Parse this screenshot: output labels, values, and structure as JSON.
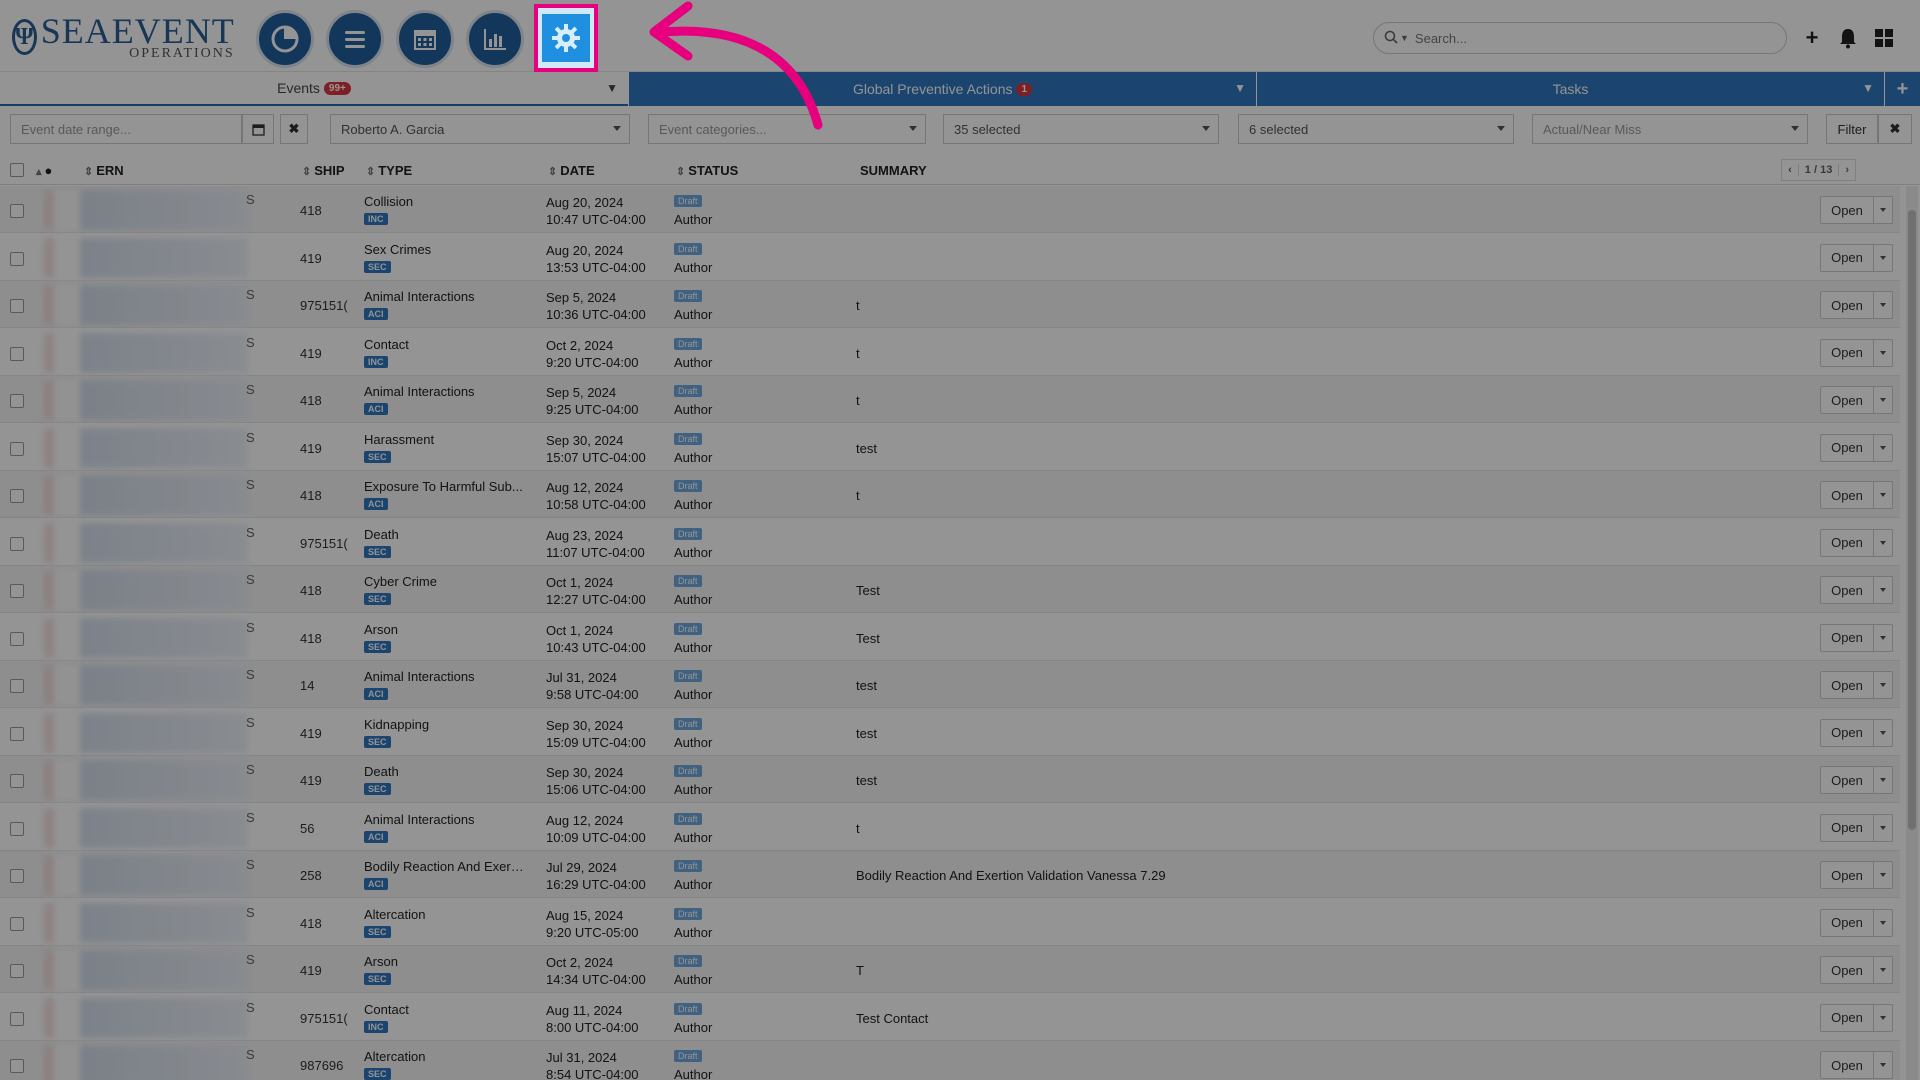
{
  "app": {
    "logo_main": "SEAEVENT",
    "logo_sub": "OPERATIONS",
    "logo_mark": "Ψ"
  },
  "nav": {
    "icons": [
      "dashboard-pie-icon",
      "list-icon",
      "calendar-icon",
      "bar-chart-icon",
      "gear-icon"
    ]
  },
  "header": {
    "search_placeholder": "Search...",
    "add_icon": "+",
    "bell_icon": "bell-icon",
    "apps_icon": "grid-icon"
  },
  "tabs": [
    {
      "label": "Events",
      "badge": "99+"
    },
    {
      "label": "Global Preventive Actions",
      "badge": "1"
    },
    {
      "label": "Tasks",
      "badge": ""
    }
  ],
  "filters": {
    "date_placeholder": "Event date range...",
    "user_value": "Roberto A. Garcia",
    "category_placeholder": "Event categories...",
    "ships_value": "35 selected",
    "types_value": "6 selected",
    "classification_placeholder": "Actual/Near Miss",
    "filter_label": "Filter",
    "clear_label": "✖"
  },
  "table": {
    "columns": {
      "ern": "ERN",
      "ship": "SHIP",
      "type": "TYPE",
      "date": "DATE",
      "status": "STATUS",
      "summary": "SUMMARY"
    },
    "pager": "1 / 13",
    "open_label": "Open",
    "rows": [
      {
        "ern_s": "S",
        "ship": "418",
        "type": "Collision",
        "tag": "INC",
        "date1": "Aug 20, 2024",
        "date2": "10:47 UTC-04:00",
        "status": "Draft",
        "role": "Author",
        "summary": ""
      },
      {
        "ern_s": "",
        "ship": "419",
        "type": "Sex Crimes",
        "tag": "SEC",
        "date1": "Aug 20, 2024",
        "date2": "13:53 UTC-04:00",
        "status": "Draft",
        "role": "Author",
        "summary": ""
      },
      {
        "ern_s": "S",
        "ship": "975151(",
        "type": "Animal Interactions",
        "tag": "ACI",
        "date1": "Sep 5, 2024",
        "date2": "10:36 UTC-04:00",
        "status": "Draft",
        "role": "Author",
        "summary": "t"
      },
      {
        "ern_s": "S",
        "ship": "419",
        "type": "Contact",
        "tag": "INC",
        "date1": "Oct 2, 2024",
        "date2": "9:20 UTC-04:00",
        "status": "Draft",
        "role": "Author",
        "summary": "t"
      },
      {
        "ern_s": "S",
        "ship": "418",
        "type": "Animal Interactions",
        "tag": "ACI",
        "date1": "Sep 5, 2024",
        "date2": "9:25 UTC-04:00",
        "status": "Draft",
        "role": "Author",
        "summary": "t"
      },
      {
        "ern_s": "S",
        "ship": "419",
        "type": "Harassment",
        "tag": "SEC",
        "date1": "Sep 30, 2024",
        "date2": "15:07 UTC-04:00",
        "status": "Draft",
        "role": "Author",
        "summary": "test"
      },
      {
        "ern_s": "S",
        "ship": "418",
        "type": "Exposure To Harmful Sub...",
        "tag": "ACI",
        "date1": "Aug 12, 2024",
        "date2": "10:58 UTC-04:00",
        "status": "Draft",
        "role": "Author",
        "summary": "t"
      },
      {
        "ern_s": "S",
        "ship": "975151(",
        "type": "Death",
        "tag": "SEC",
        "date1": "Aug 23, 2024",
        "date2": "11:07 UTC-04:00",
        "status": "Draft",
        "role": "Author",
        "summary": ""
      },
      {
        "ern_s": "S",
        "ship": "418",
        "type": "Cyber Crime",
        "tag": "SEC",
        "date1": "Oct 1, 2024",
        "date2": "12:27 UTC-04:00",
        "status": "Draft",
        "role": "Author",
        "summary": "Test"
      },
      {
        "ern_s": "S",
        "ship": "418",
        "type": "Arson",
        "tag": "SEC",
        "date1": "Oct 1, 2024",
        "date2": "10:43 UTC-04:00",
        "status": "Draft",
        "role": "Author",
        "summary": "Test"
      },
      {
        "ern_s": "S",
        "ship": "14",
        "type": "Animal Interactions",
        "tag": "ACI",
        "date1": "Jul 31, 2024",
        "date2": "9:58 UTC-04:00",
        "status": "Draft",
        "role": "Author",
        "summary": "test"
      },
      {
        "ern_s": "S",
        "ship": "419",
        "type": "Kidnapping",
        "tag": "SEC",
        "date1": "Sep 30, 2024",
        "date2": "15:09 UTC-04:00",
        "status": "Draft",
        "role": "Author",
        "summary": "test"
      },
      {
        "ern_s": "S",
        "ship": "419",
        "type": "Death",
        "tag": "SEC",
        "date1": "Sep 30, 2024",
        "date2": "15:06 UTC-04:00",
        "status": "Draft",
        "role": "Author",
        "summary": "test"
      },
      {
        "ern_s": "S",
        "ship": "56",
        "type": "Animal Interactions",
        "tag": "ACI",
        "date1": "Aug 12, 2024",
        "date2": "10:09 UTC-04:00",
        "status": "Draft",
        "role": "Author",
        "summary": "t"
      },
      {
        "ern_s": "S",
        "ship": "258",
        "type": "Bodily Reaction And Exert...",
        "tag": "ACI",
        "date1": "Jul 29, 2024",
        "date2": "16:29 UTC-04:00",
        "status": "Draft",
        "role": "Author",
        "summary": "Bodily Reaction And Exertion Validation Vanessa 7.29"
      },
      {
        "ern_s": "S",
        "ship": "418",
        "type": "Altercation",
        "tag": "SEC",
        "date1": "Aug 15, 2024",
        "date2": "9:20 UTC-05:00",
        "status": "Draft",
        "role": "Author",
        "summary": ""
      },
      {
        "ern_s": "S",
        "ship": "419",
        "type": "Arson",
        "tag": "SEC",
        "date1": "Oct 2, 2024",
        "date2": "14:34 UTC-04:00",
        "status": "Draft",
        "role": "Author",
        "summary": "T"
      },
      {
        "ern_s": "S",
        "ship": "975151(",
        "type": "Contact",
        "tag": "INC",
        "date1": "Aug 11, 2024",
        "date2": "8:00 UTC-04:00",
        "status": "Draft",
        "role": "Author",
        "summary": "Test Contact"
      },
      {
        "ern_s": "S",
        "ship": "987696",
        "type": "Altercation",
        "tag": "SEC",
        "date1": "Jul 31, 2024",
        "date2": "8:54 UTC-04:00",
        "status": "Draft",
        "role": "Author",
        "summary": ""
      }
    ]
  },
  "colors": {
    "brand": "#1f5f9c",
    "tab_active": "#2f75be",
    "highlight": "#e6007e",
    "badge": "#d9363e"
  }
}
